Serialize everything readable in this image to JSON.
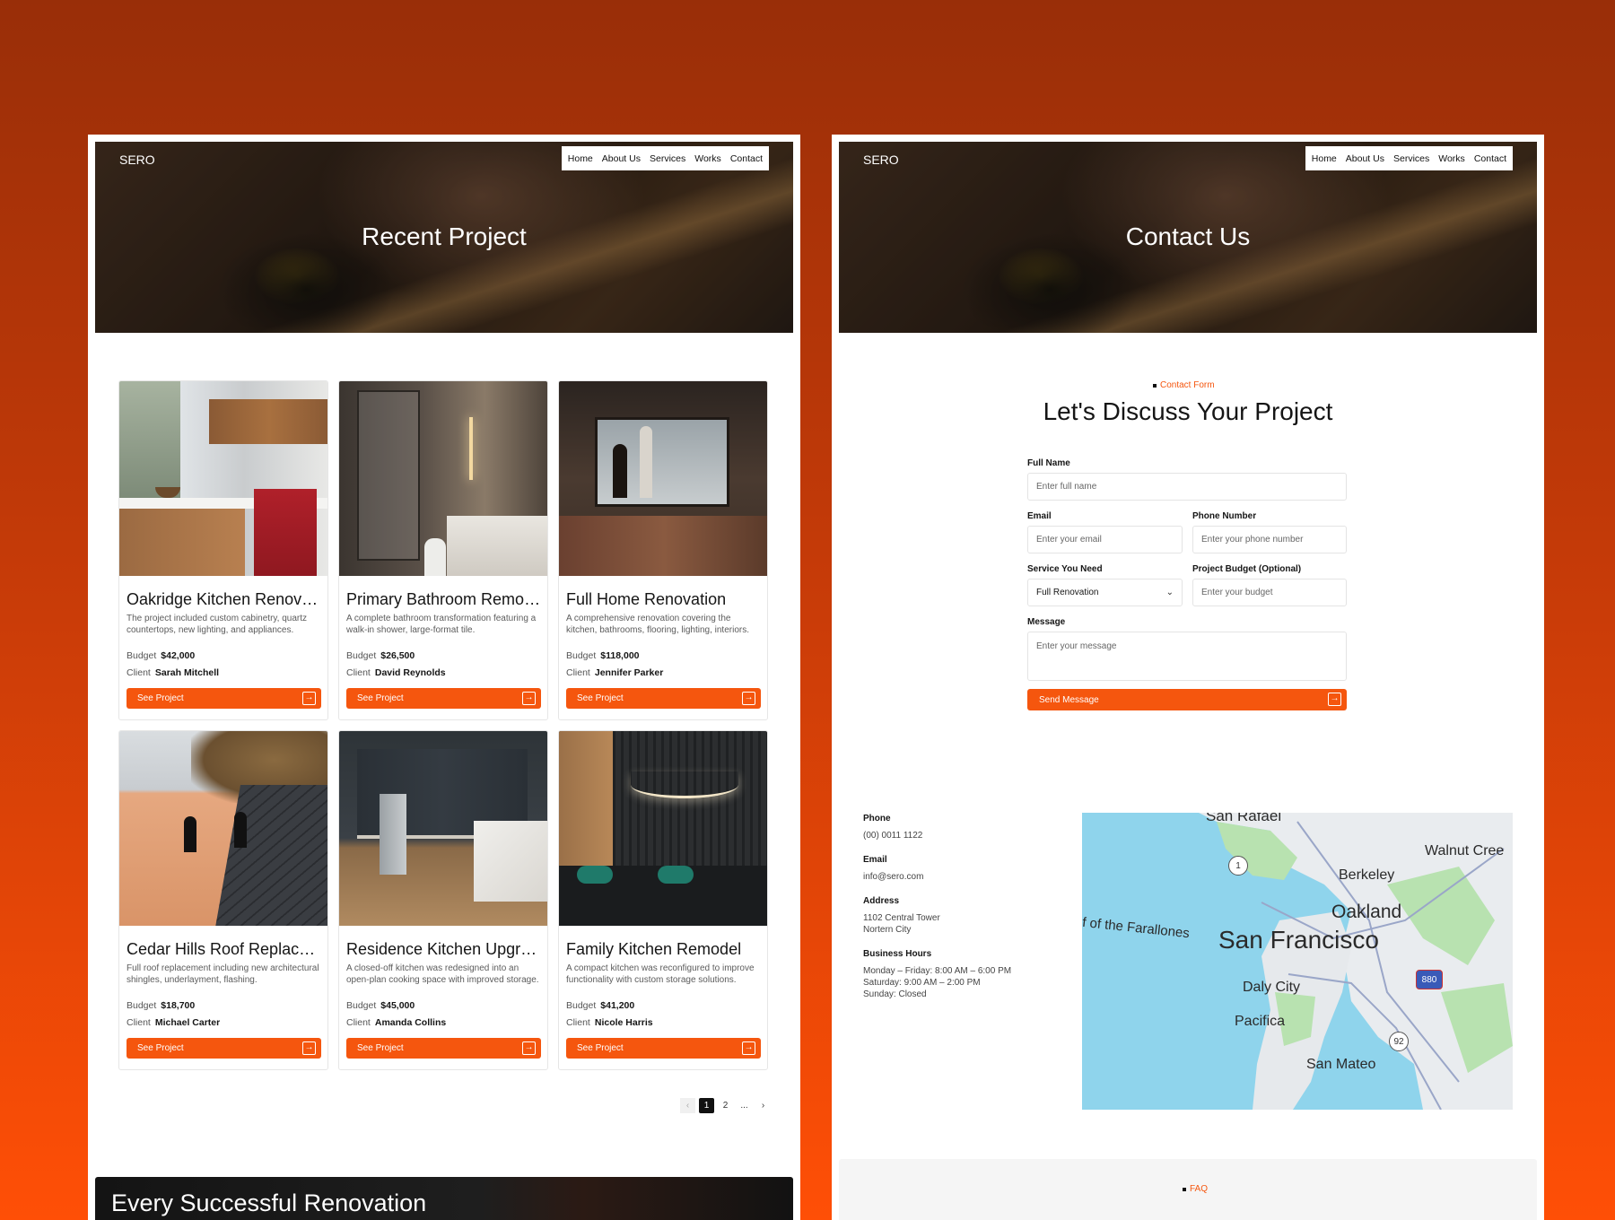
{
  "left_page": {
    "brand": "SERO",
    "nav": [
      "Home",
      "About Us",
      "Services",
      "Works",
      "Contact"
    ],
    "hero_title": "Recent Project",
    "projects": [
      {
        "title": "Oakridge Kitchen Renovation",
        "desc": "The project included custom cabinetry, quartz countertops, new lighting, and appliances.",
        "budget": "$42,000",
        "client": "Sarah Mitchell"
      },
      {
        "title": "Primary Bathroom Remodel",
        "desc": "A complete bathroom transformation featuring a walk-in shower, large-format tile.",
        "budget": "$26,500",
        "client": "David Reynolds"
      },
      {
        "title": "Full Home Renovation",
        "desc": "A comprehensive renovation covering the kitchen, bathrooms, flooring, lighting, interiors.",
        "budget": "$118,000",
        "client": "Jennifer Parker"
      },
      {
        "title": "Cedar Hills Roof Replacement",
        "desc": "Full roof replacement including new architectural shingles, underlayment, flashing.",
        "budget": "$18,700",
        "client": "Michael Carter"
      },
      {
        "title": "Residence Kitchen Upgrade",
        "desc": "A closed-off kitchen was redesigned into an open-plan cooking space with improved storage.",
        "budget": "$45,000",
        "client": "Amanda Collins"
      },
      {
        "title": "Family Kitchen Remodel",
        "desc": "A compact kitchen was reconfigured to improve functionality with custom storage solutions.",
        "budget": "$41,200",
        "client": "Nicole Harris"
      }
    ],
    "budget_label": "Budget",
    "client_label": "Client",
    "see_project_label": "See Project",
    "pagination": {
      "prev": "‹",
      "pages": [
        "1",
        "2",
        "..."
      ],
      "next": "›"
    },
    "banner_title": "Every Successful Renovation"
  },
  "right_page": {
    "brand": "SERO",
    "nav": [
      "Home",
      "About Us",
      "Services",
      "Works",
      "Contact"
    ],
    "hero_title": "Contact Us",
    "eyebrow": "Contact Form",
    "form_title": "Let's Discuss Your Project",
    "fields": {
      "full_name": {
        "label": "Full Name",
        "placeholder": "Enter full name"
      },
      "email": {
        "label": "Email",
        "placeholder": "Enter your email"
      },
      "phone": {
        "label": "Phone Number",
        "placeholder": "Enter your phone number"
      },
      "service": {
        "label": "Service You Need",
        "value": "Full Renovation"
      },
      "budget": {
        "label": "Project Budget (Optional)",
        "placeholder": "Enter your budget"
      },
      "message": {
        "label": "Message",
        "placeholder": "Enter your message"
      }
    },
    "send_label": "Send Message",
    "info": {
      "phone_label": "Phone",
      "phone": "(00) 0011 1122",
      "email_label": "Email",
      "email": "info@sero.com",
      "address_label": "Address",
      "address_1": "1102 Central Tower",
      "address_2": "Nortern City",
      "hours_label": "Business Hours",
      "hours_1": "Monday – Friday: 8:00 AM – 6:00 PM",
      "hours_2": "Saturday: 9:00 AM – 2:00 PM",
      "hours_3": "Sunday: Closed"
    },
    "map": {
      "labels": [
        "San Rafael",
        "Walnut Cree",
        "Berkeley",
        "Oakland",
        "f of the Farallones",
        "San Francisco",
        "Daly City",
        "Pacifica",
        "San Mateo"
      ],
      "badges": [
        "1",
        "880",
        "92"
      ]
    },
    "faq_eyebrow": "FAQ"
  },
  "colors": {
    "accent": "#f5560e",
    "background_top": "#992e08",
    "background_bottom": "#ff4f06"
  }
}
